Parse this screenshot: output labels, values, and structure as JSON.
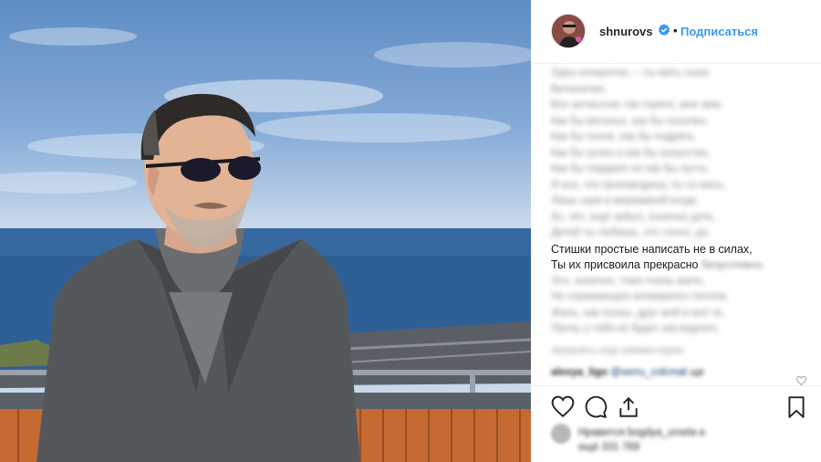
{
  "post": {
    "username": "shnurovs",
    "verified_icon": "verified-badge-icon",
    "separator": "•",
    "follow_label": "Подписаться",
    "caption_lines": [
      {
        "text": "Одно конкретно, – ты мать сына",
        "blurred": true
      },
      {
        "text": "Витюлечки,",
        "blurred": true
      },
      {
        "text": "Все антасогие так горячо, мне аем.",
        "blurred": true
      },
      {
        "text": "Как бы веселье, как бы поселке,",
        "blurred": true
      },
      {
        "text": "Как бы поэзе, как бы подряга.",
        "blurred": true
      },
      {
        "text": "Как бы успех и как бы искусство,",
        "blurred": true
      },
      {
        "text": "Как бы подарил не как бы пусто,",
        "blurred": true
      },
      {
        "text": "И все, что производишь ты со мать,",
        "blurred": true
      },
      {
        "text": "Лишь шум и мирамакой когда.",
        "blurred": true
      },
      {
        "text": "Ах, чёт, ещё забыл, конечно дочь.",
        "blurred": true
      },
      {
        "text": "Детей ты любишь, это точно, да.",
        "blurred": true
      },
      {
        "text": "Стишки простые написать не в силах,",
        "blurred": false
      },
      {
        "text": "Ты их присвоила прекрасно",
        "blurred": false,
        "tail": "безусловно."
      },
      {
        "text": "Это, конечно, тоже очень мило,",
        "blurred": true
      },
      {
        "text": "Не отражающее всемирного потопа.",
        "blurred": true
      },
      {
        "text": "Жаль, как поэзы, друг мой и всё та,",
        "blurred": true
      },
      {
        "text": "Прочь у тебя не будет наследного.",
        "blurred": true
      }
    ],
    "load_more": "Загрузить еще комментарии",
    "comment": {
      "user": "alexya_ligo",
      "mention": "@serru_colcmat",
      "text": "ще"
    },
    "likes_text_1": "Нравится bogdya_ursela и",
    "likes_text_2": "ещё 331 769"
  },
  "icons": {
    "like": "heart-icon",
    "comment": "comment-icon",
    "share": "share-icon",
    "save": "bookmark-icon",
    "comment_like": "small-heart-icon"
  },
  "colors": {
    "link_blue": "#3897f0",
    "text_dark": "#262626",
    "divider": "#efefef"
  }
}
